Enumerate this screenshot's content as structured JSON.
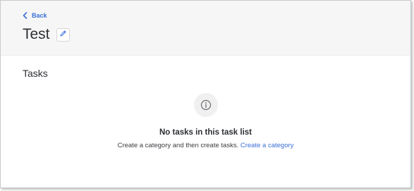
{
  "header": {
    "back_label": "Back",
    "title": "Test"
  },
  "section": {
    "title": "Tasks"
  },
  "empty_state": {
    "title": "No tasks in this task list",
    "description": "Create a category and then create tasks.",
    "link_label": "Create a category"
  },
  "icons": {
    "back": "chevron-left-icon",
    "edit": "pencil-icon",
    "info": "info-icon"
  },
  "colors": {
    "accent": "#3b6fd6",
    "header_bg": "#f6f6f6",
    "text": "#2d2f33"
  }
}
